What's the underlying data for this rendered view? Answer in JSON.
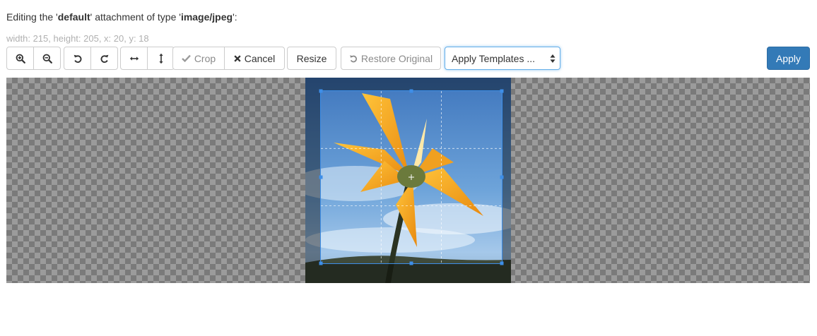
{
  "heading": {
    "prefix": "Editing the '",
    "attachment_name": "default",
    "middle": "' attachment of type '",
    "mime_type": "image/jpeg",
    "suffix": "':"
  },
  "crop_info": "width: 215, height: 205, x: 20, y: 18",
  "toolbar": {
    "crop_label": "Crop",
    "cancel_label": "Cancel",
    "resize_label": "Resize",
    "restore_label": "Restore Original",
    "templates_selected": "Apply Templates ...",
    "apply_label": "Apply"
  },
  "icons": {
    "zoom_in": "zoom-in-icon",
    "zoom_out": "zoom-out-icon",
    "rotate_left": "rotate-left-icon",
    "rotate_right": "rotate-right-icon",
    "flip_horizontal": "flip-horizontal-icon",
    "flip_vertical": "flip-vertical-icon",
    "crop": "check-icon",
    "cancel": "close-icon",
    "restore": "undo-icon",
    "select": "select-arrows-icon"
  },
  "colors": {
    "primary": "#337ab7",
    "crop_border": "#3d8ee8",
    "focus": "#66afe9",
    "petal": "#f5a623",
    "sky": "#5f97d6"
  }
}
